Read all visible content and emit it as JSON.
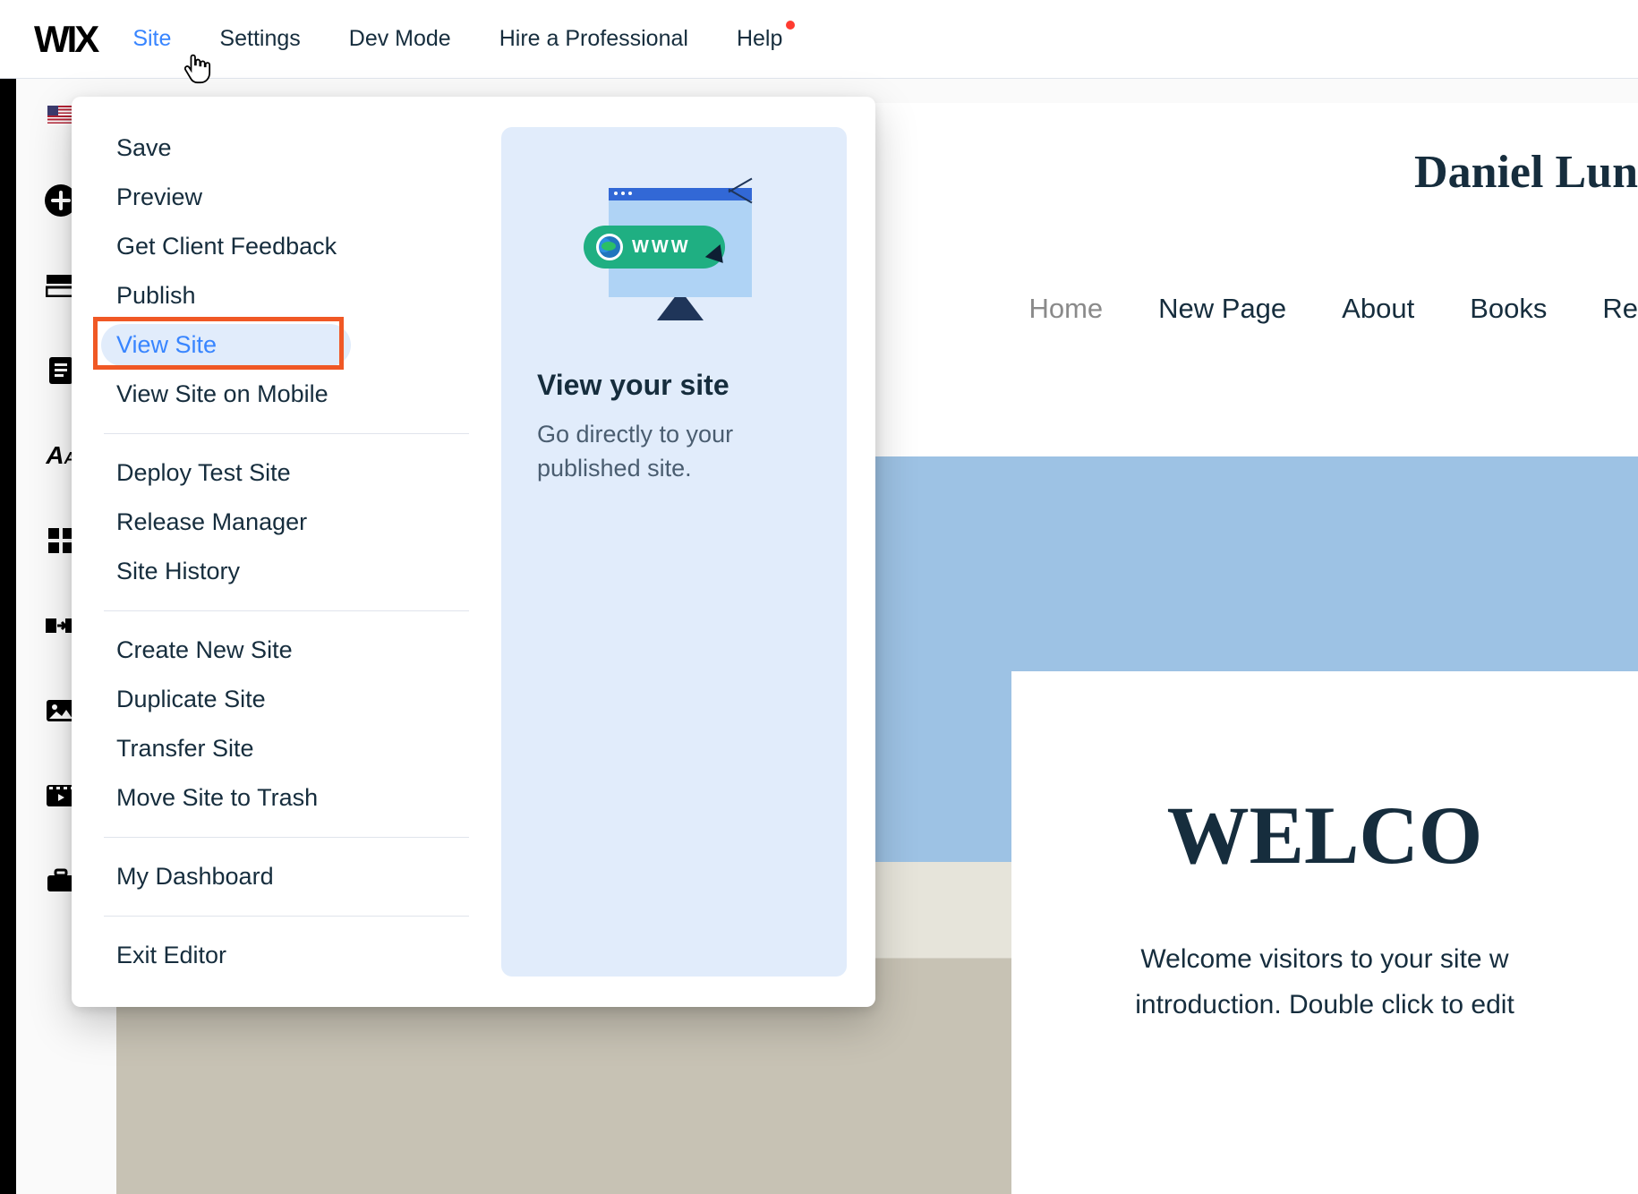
{
  "topnav": {
    "logo": "WIX",
    "items": [
      "Site",
      "Settings",
      "Dev Mode",
      "Hire a Professional",
      "Help"
    ],
    "active_index": 0
  },
  "site_menu": {
    "groups": [
      [
        "Save",
        "Preview",
        "Get Client Feedback",
        "Publish",
        "View Site",
        "View Site on Mobile"
      ],
      [
        "Deploy Test Site",
        "Release Manager",
        "Site History"
      ],
      [
        "Create New Site",
        "Duplicate Site",
        "Transfer Site",
        "Move Site to Trash"
      ],
      [
        "My Dashboard"
      ],
      [
        "Exit Editor"
      ]
    ],
    "selected": "View Site",
    "info": {
      "www_label": "WWW",
      "title": "View your site",
      "desc": "Go directly to your published site."
    }
  },
  "tool_icons": [
    "flag-icon",
    "add-icon",
    "section-icon",
    "page-icon",
    "text-icon",
    "apps-icon",
    "transition-icon",
    "image-icon",
    "video-icon",
    "briefcase-icon"
  ],
  "site_preview": {
    "title": "Daniel Lun",
    "nav": [
      "Home",
      "New Page",
      "About",
      "Books",
      "Re"
    ],
    "nav_active_index": 0,
    "welcome_heading": "WELCO",
    "welcome_p1": "Welcome visitors to your site w",
    "welcome_p2": "introduction. Double click to edit "
  }
}
